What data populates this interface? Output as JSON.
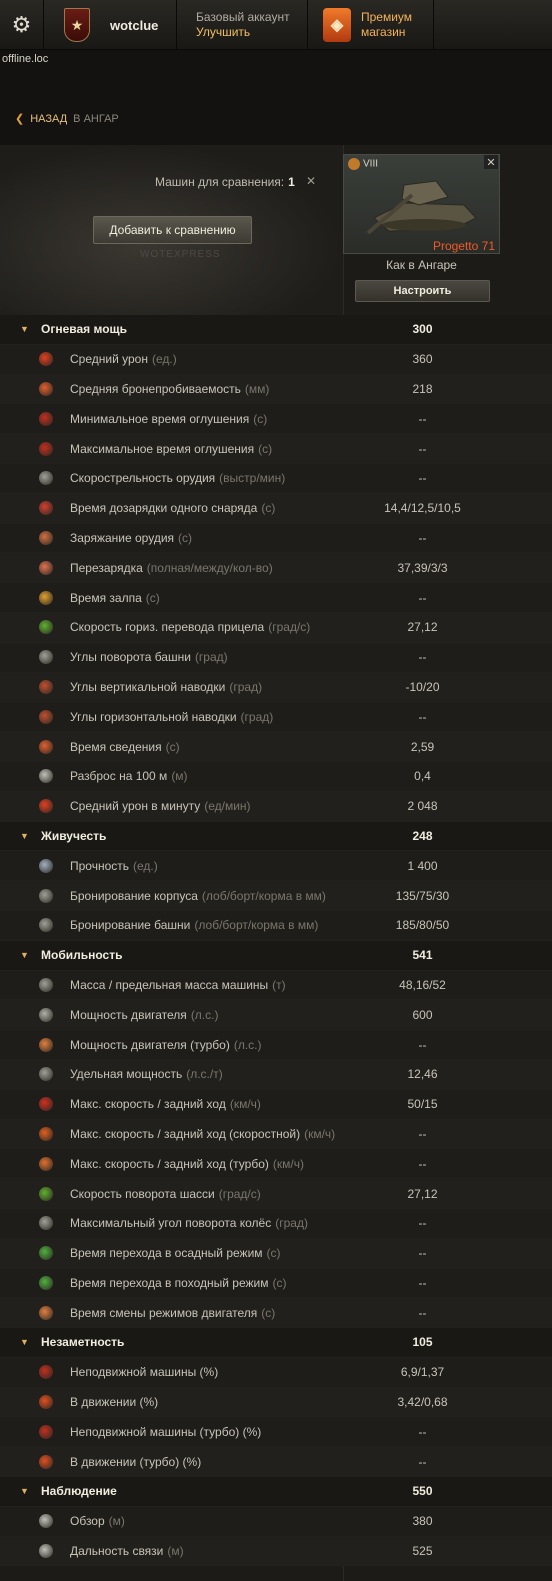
{
  "header": {
    "username": "wotclue",
    "account_type": "Базовый аккаунт",
    "upgrade": "Улучшить",
    "premium_line1": "Премиум",
    "premium_line2": "магазин",
    "server": "offline.loc"
  },
  "nav": {
    "back": "НАЗАД",
    "back_sub": "В АНГАР"
  },
  "compare": {
    "label": "Машин для сравнения:",
    "count": "1",
    "close": "✕",
    "add_button": "Добавить к сравнению",
    "watermark": "WOTEXPRESS"
  },
  "tank": {
    "tier": "VIII",
    "name": "Progetto 71",
    "config_label": "Как в Ангаре",
    "configure_button": "Настроить",
    "close": "✕"
  },
  "categories": [
    {
      "name": "Огневая мощь",
      "value": "300",
      "stats": [
        {
          "name": "Средний урон",
          "unit": "(ед.)",
          "value": "360",
          "icon": "damage-icon",
          "color": "#e04020"
        },
        {
          "name": "Средняя бронепробиваемость",
          "unit": "(мм)",
          "value": "218",
          "icon": "penetration-icon",
          "color": "#e06030"
        },
        {
          "name": "Минимальное время оглушения",
          "unit": "(с)",
          "value": "--",
          "icon": "stun-min-icon",
          "color": "#c03020"
        },
        {
          "name": "Максимальное время оглушения",
          "unit": "(с)",
          "value": "--",
          "icon": "stun-max-icon",
          "color": "#c03020"
        },
        {
          "name": "Скорострельность орудия",
          "unit": "(выстр/мин)",
          "value": "--",
          "icon": "rate-of-fire-icon",
          "color": "#a0a098"
        },
        {
          "name": "Время дозарядки одного снаряда",
          "unit": "(с)",
          "value": "14,4/12,5/10,5",
          "icon": "shell-reload-icon",
          "color": "#d04030"
        },
        {
          "name": "Заряжание орудия",
          "unit": "(с)",
          "value": "--",
          "icon": "loading-icon",
          "color": "#d07040"
        },
        {
          "name": "Перезарядка",
          "unit": "(полная/между/кол-во)",
          "value": "37,39/3/3",
          "icon": "reload-icon",
          "color": "#e07050"
        },
        {
          "name": "Время залпа",
          "unit": "(с)",
          "value": "--",
          "icon": "salvo-icon",
          "color": "#e0a030"
        },
        {
          "name": "Скорость гориз. перевода прицела",
          "unit": "(град/с)",
          "value": "27,12",
          "icon": "traverse-icon",
          "color": "#60b030"
        },
        {
          "name": "Углы поворота башни",
          "unit": "(град)",
          "value": "--",
          "icon": "turret-angles-icon",
          "color": "#a0a098"
        },
        {
          "name": "Углы вертикальной наводки",
          "unit": "(град)",
          "value": "-10/20",
          "icon": "vertical-angles-icon",
          "color": "#c05030"
        },
        {
          "name": "Углы горизонтальной наводки",
          "unit": "(град)",
          "value": "--",
          "icon": "horizontal-angles-icon",
          "color": "#c05030"
        },
        {
          "name": "Время сведения",
          "unit": "(с)",
          "value": "2,59",
          "icon": "aim-time-icon",
          "color": "#e06030"
        },
        {
          "name": "Разброс на 100 м",
          "unit": "(м)",
          "value": "0,4",
          "icon": "dispersion-icon",
          "color": "#c0c0b8"
        },
        {
          "name": "Средний урон в минуту",
          "unit": "(ед/мин)",
          "value": "2 048",
          "icon": "dpm-icon",
          "color": "#e04020"
        }
      ]
    },
    {
      "name": "Живучесть",
      "value": "248",
      "stats": [
        {
          "name": "Прочность",
          "unit": "(ед.)",
          "value": "1 400",
          "icon": "hitpoints-icon",
          "color": "#a0b0c0"
        },
        {
          "name": "Бронирование корпуса",
          "unit": "(лоб/борт/корма в мм)",
          "value": "135/75/30",
          "icon": "hull-armor-icon",
          "color": "#a0a098"
        },
        {
          "name": "Бронирование башни",
          "unit": "(лоб/борт/корма в мм)",
          "value": "185/80/50",
          "icon": "turret-armor-icon",
          "color": "#a0a098"
        }
      ]
    },
    {
      "name": "Мобильность",
      "value": "541",
      "stats": [
        {
          "name": "Масса / предельная масса машины",
          "unit": "(т)",
          "value": "48,16/52",
          "icon": "weight-icon",
          "color": "#a0a098"
        },
        {
          "name": "Мощность двигателя",
          "unit": "(л.с.)",
          "value": "600",
          "icon": "engine-power-icon",
          "color": "#b0b0a8"
        },
        {
          "name": "Мощность двигателя (турбо)",
          "unit": "(л.с.)",
          "value": "--",
          "icon": "engine-turbo-icon",
          "color": "#e08040"
        },
        {
          "name": "Удельная мощность",
          "unit": "(л.с./т)",
          "value": "12,46",
          "icon": "specific-power-icon",
          "color": "#a0a098"
        },
        {
          "name": "Макс. скорость / задний ход",
          "unit": "(км/ч)",
          "value": "50/15",
          "icon": "speed-icon",
          "color": "#d03020"
        },
        {
          "name": "Макс. скорость / задний ход (скоростной)",
          "unit": "(км/ч)",
          "value": "--",
          "icon": "speed-fast-icon",
          "color": "#e06020"
        },
        {
          "name": "Макс. скорость / задний ход (турбо)",
          "unit": "(км/ч)",
          "value": "--",
          "icon": "speed-turbo-icon",
          "color": "#e07030"
        },
        {
          "name": "Скорость поворота шасси",
          "unit": "(град/с)",
          "value": "27,12",
          "icon": "hull-traverse-icon",
          "color": "#60b030"
        },
        {
          "name": "Максимальный угол поворота колёс",
          "unit": "(град)",
          "value": "--",
          "icon": "wheel-angle-icon",
          "color": "#a0a098"
        },
        {
          "name": "Время перехода в осадный режим",
          "unit": "(с)",
          "value": "--",
          "icon": "siege-mode-icon",
          "color": "#50b040"
        },
        {
          "name": "Время перехода в походный режим",
          "unit": "(с)",
          "value": "--",
          "icon": "travel-mode-icon",
          "color": "#50b040"
        },
        {
          "name": "Время смены режимов двигателя",
          "unit": "(с)",
          "value": "--",
          "icon": "engine-mode-icon",
          "color": "#e08040"
        }
      ]
    },
    {
      "name": "Незаметность",
      "value": "105",
      "stats": [
        {
          "name": "Неподвижной машины (%)",
          "unit": "",
          "value": "6,9/1,37",
          "icon": "camo-stationary-icon",
          "color": "#c03020"
        },
        {
          "name": "В движении (%)",
          "unit": "",
          "value": "3,42/0,68",
          "icon": "camo-moving-icon",
          "color": "#e05020"
        },
        {
          "name": "Неподвижной машины (турбо) (%)",
          "unit": "",
          "value": "--",
          "icon": "camo-stationary-turbo-icon",
          "color": "#c03020"
        },
        {
          "name": "В движении (турбо) (%)",
          "unit": "",
          "value": "--",
          "icon": "camo-moving-turbo-icon",
          "color": "#e05020"
        }
      ]
    },
    {
      "name": "Наблюдение",
      "value": "550",
      "stats": [
        {
          "name": "Обзор",
          "unit": "(м)",
          "value": "380",
          "icon": "view-range-icon",
          "color": "#c0c0b8"
        },
        {
          "name": "Дальность связи",
          "unit": "(м)",
          "value": "525",
          "icon": "radio-range-icon",
          "color": "#c0c0b8"
        }
      ]
    }
  ]
}
